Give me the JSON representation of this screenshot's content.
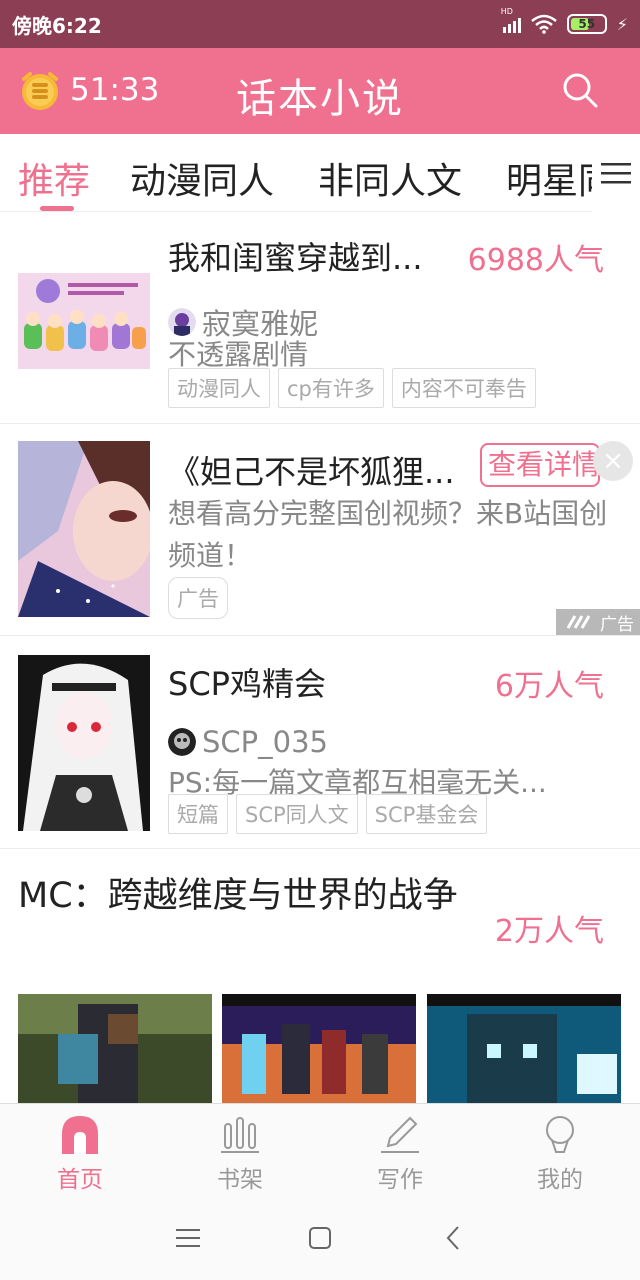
{
  "status_bar": {
    "time": "傍晚6:22",
    "network": "HD",
    "battery": "55",
    "battery_level": 0.55
  },
  "header": {
    "timer": "51:33",
    "title": "话本小说"
  },
  "tabs": [
    {
      "label": "推荐",
      "active": true
    },
    {
      "label": "动漫同人",
      "active": false
    },
    {
      "label": "非同人文",
      "active": false
    },
    {
      "label": "明星同人",
      "active": false
    }
  ],
  "feed": [
    {
      "type": "story",
      "title": "我和闺蜜穿越到...",
      "popularity": "6988人气",
      "author": "寂寞雅妮",
      "description": "不透露剧情",
      "tags": [
        "动漫同人",
        "cp有许多",
        "内容不可奉告"
      ]
    },
    {
      "type": "ad",
      "title": "《妲己不是坏狐狸...",
      "button": "查看详情",
      "close": "×",
      "description": "想看高分完整国创视频？来B站国创频道！",
      "tag": "广告",
      "badge": "广告"
    },
    {
      "type": "story",
      "title": "SCP鸡精会",
      "popularity": "6万人气",
      "author": "SCP_035",
      "description": "PS:每一篇文章都互相毫无关...",
      "tags": [
        "短篇",
        "SCP同人文",
        "SCP基金会"
      ]
    },
    {
      "type": "collection",
      "title": "MC：跨越维度与世界的战争",
      "popularity": "2万人气"
    }
  ],
  "bottom_nav": [
    {
      "label": "首页",
      "icon": "home-icon",
      "active": true
    },
    {
      "label": "书架",
      "icon": "bookshelf-icon",
      "active": false
    },
    {
      "label": "写作",
      "icon": "pen-icon",
      "active": false
    },
    {
      "label": "我的",
      "icon": "profile-icon",
      "active": false
    }
  ],
  "colors": {
    "accent": "#f0708f",
    "status_bar": "#8c3e55",
    "text": "#222222",
    "muted": "#888888"
  }
}
